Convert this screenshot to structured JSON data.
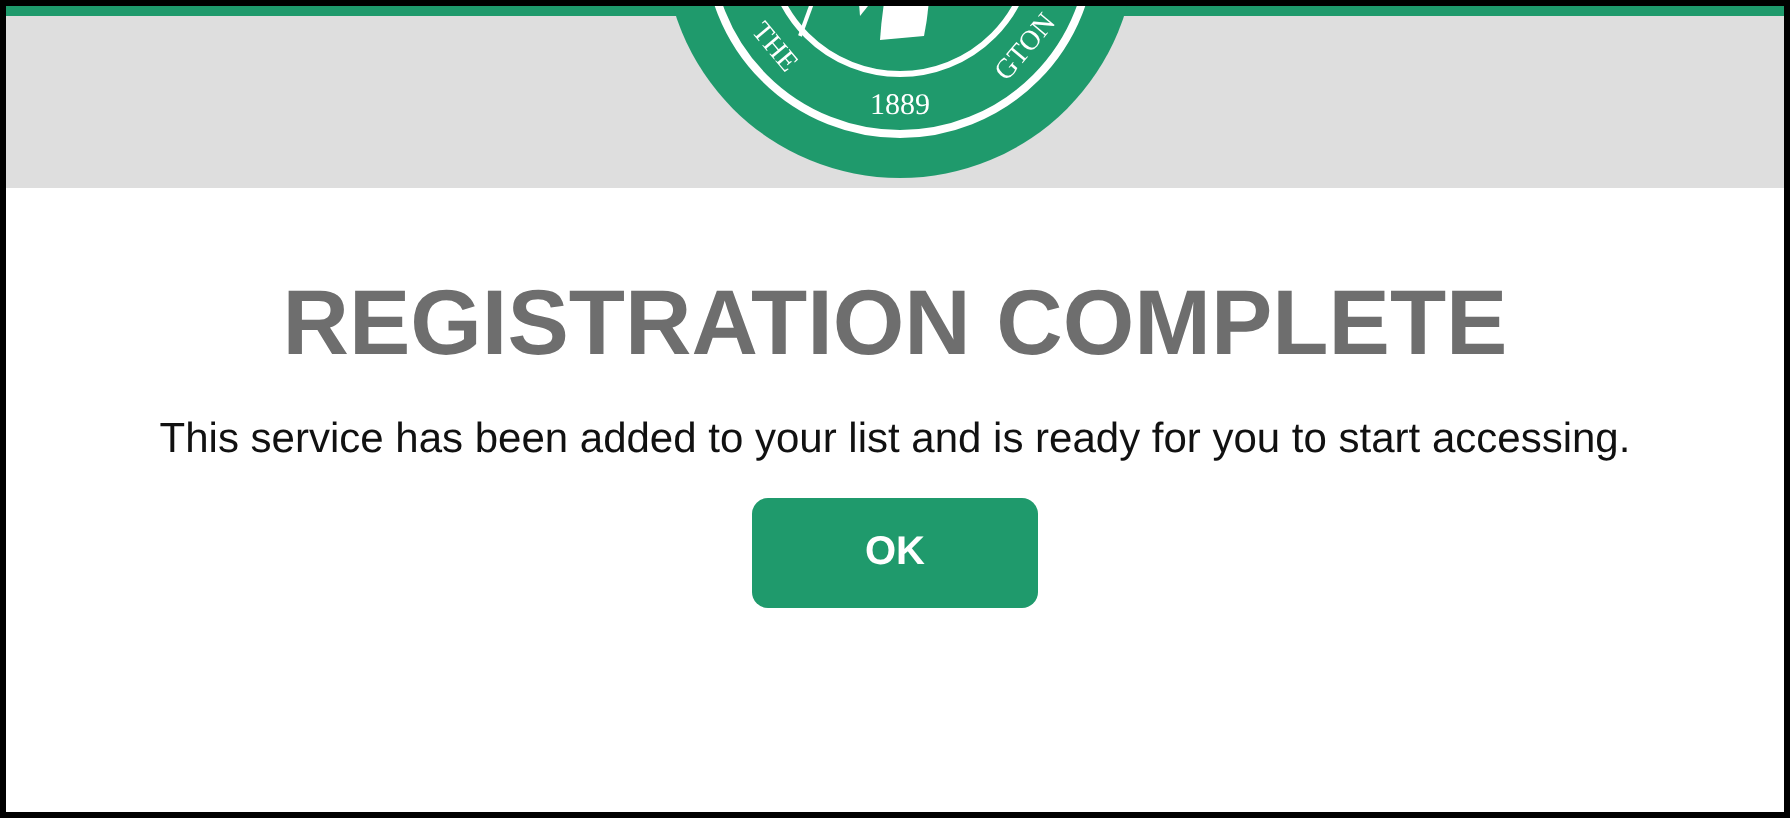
{
  "seal": {
    "texts": [
      "THE",
      "1889",
      "GTON"
    ]
  },
  "title": "REGISTRATION COMPLETE",
  "message": "This service has been added to your list and is ready for you to start accessing.",
  "buttons": [
    "OK"
  ]
}
